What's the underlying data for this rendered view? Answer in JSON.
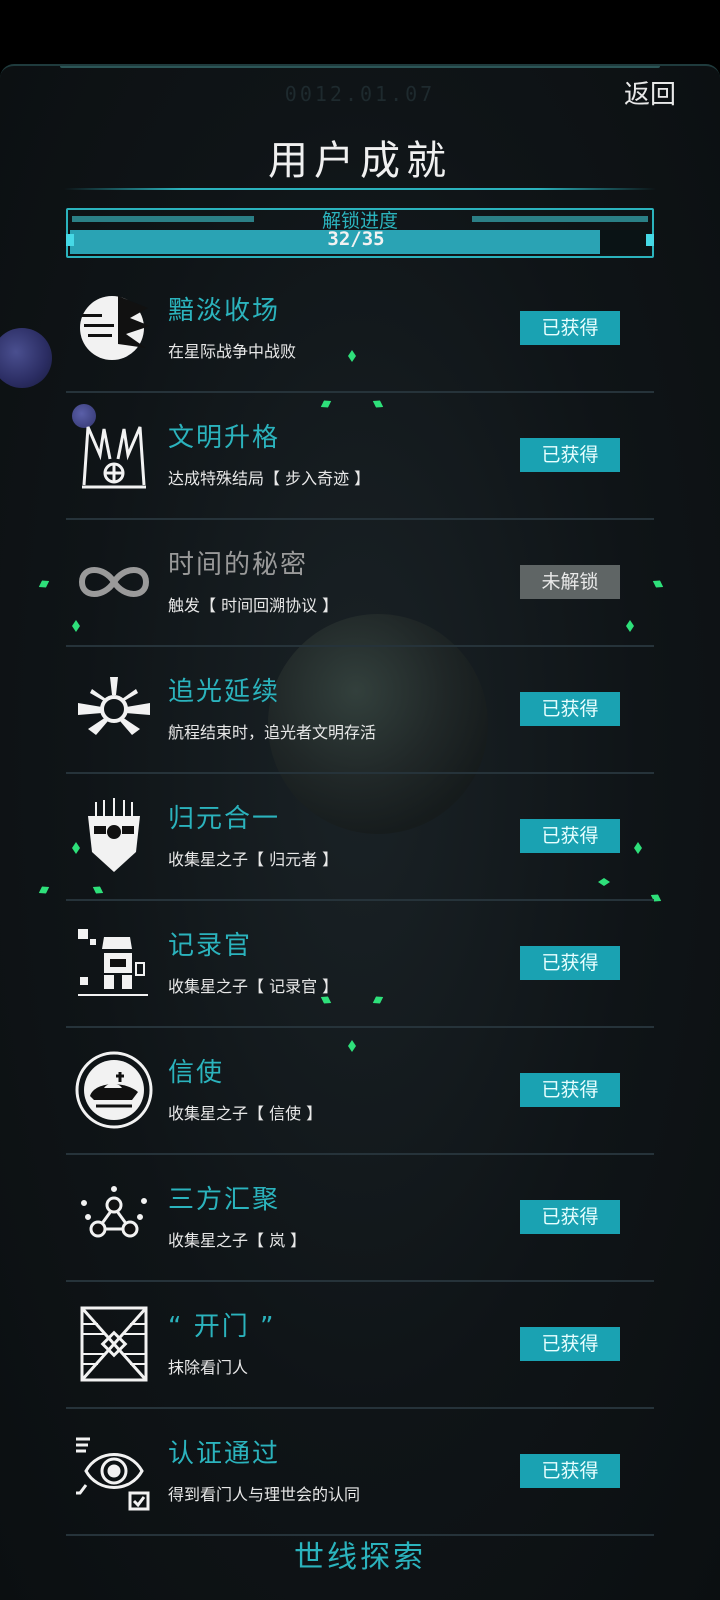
{
  "header": {
    "date": "0012.01.07",
    "back_label": "返回",
    "title": "用户成就"
  },
  "progress": {
    "label": "解锁进度",
    "count_text": "32/35",
    "unlocked": 32,
    "total": 35
  },
  "colors": {
    "accent": "#2bb3bd",
    "badge_unlocked": "#1aa2b2",
    "badge_locked": "#5f6565"
  },
  "achievements": [
    {
      "title": "黯淡收场",
      "desc": "在星际战争中战败",
      "status": "已获得",
      "icon": "broken-moon-icon"
    },
    {
      "title": "文明升格",
      "desc": "达成特殊结局【 步入奇迹 】",
      "status": "已获得",
      "icon": "winged-emblem-icon"
    },
    {
      "title": "时间的秘密",
      "desc": "触发【 时间回溯协议 】",
      "status": "未解锁",
      "icon": "infinity-icon"
    },
    {
      "title": "追光延续",
      "desc": "航程结束时，追光者文明存活",
      "status": "已获得",
      "icon": "radiant-ship-icon"
    },
    {
      "title": "归元合一",
      "desc": "收集星之子【 归元者 】",
      "status": "已获得",
      "icon": "mask-icon"
    },
    {
      "title": "记录官",
      "desc": "收集星之子【 记录官 】",
      "status": "已获得",
      "icon": "robot-icon"
    },
    {
      "title": "信使",
      "desc": "收集星之子【 信使 】",
      "status": "已获得",
      "icon": "spaceship-icon"
    },
    {
      "title": "三方汇聚",
      "desc": "收集星之子【 岚 】",
      "status": "已获得",
      "icon": "network-people-icon"
    },
    {
      "title": "“ 开门 ”",
      "desc": "抹除看门人",
      "status": "已获得",
      "icon": "gate-icon"
    },
    {
      "title": "认证通过",
      "desc": "得到看门人与理世会的认同",
      "status": "已获得",
      "icon": "eye-verify-icon"
    }
  ],
  "footer": {
    "title": "世线探索"
  }
}
